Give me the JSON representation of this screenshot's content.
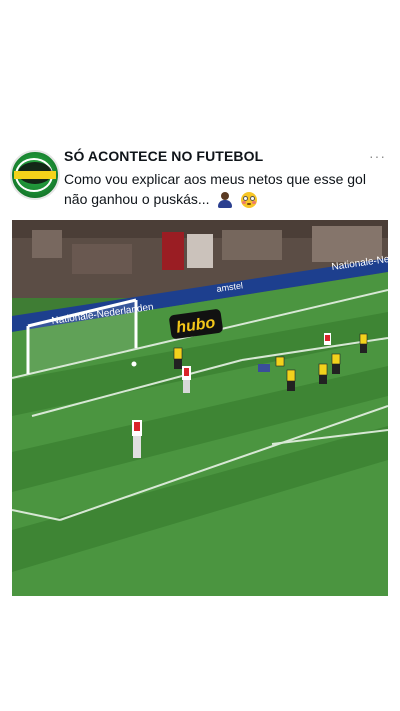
{
  "post": {
    "account_name": "SÓ ACONTECE NO FUTEBOL",
    "more_label": "···",
    "caption": "Como vou explicar aos meus netos que esse gol não ganhou o puskás...",
    "emojis": [
      "person-emoji",
      "flushed-face-emoji"
    ]
  },
  "video": {
    "broadcast_logo": "hubo",
    "ad_boards": [
      "Nationale-Nederlanden",
      "Nationale-Ne",
      "amstel"
    ]
  },
  "colors": {
    "pitch_light": "#4f9a3f",
    "pitch_dark": "#3f8533",
    "away_kit": "#f2d21c",
    "home_kit": "#d9252a"
  }
}
